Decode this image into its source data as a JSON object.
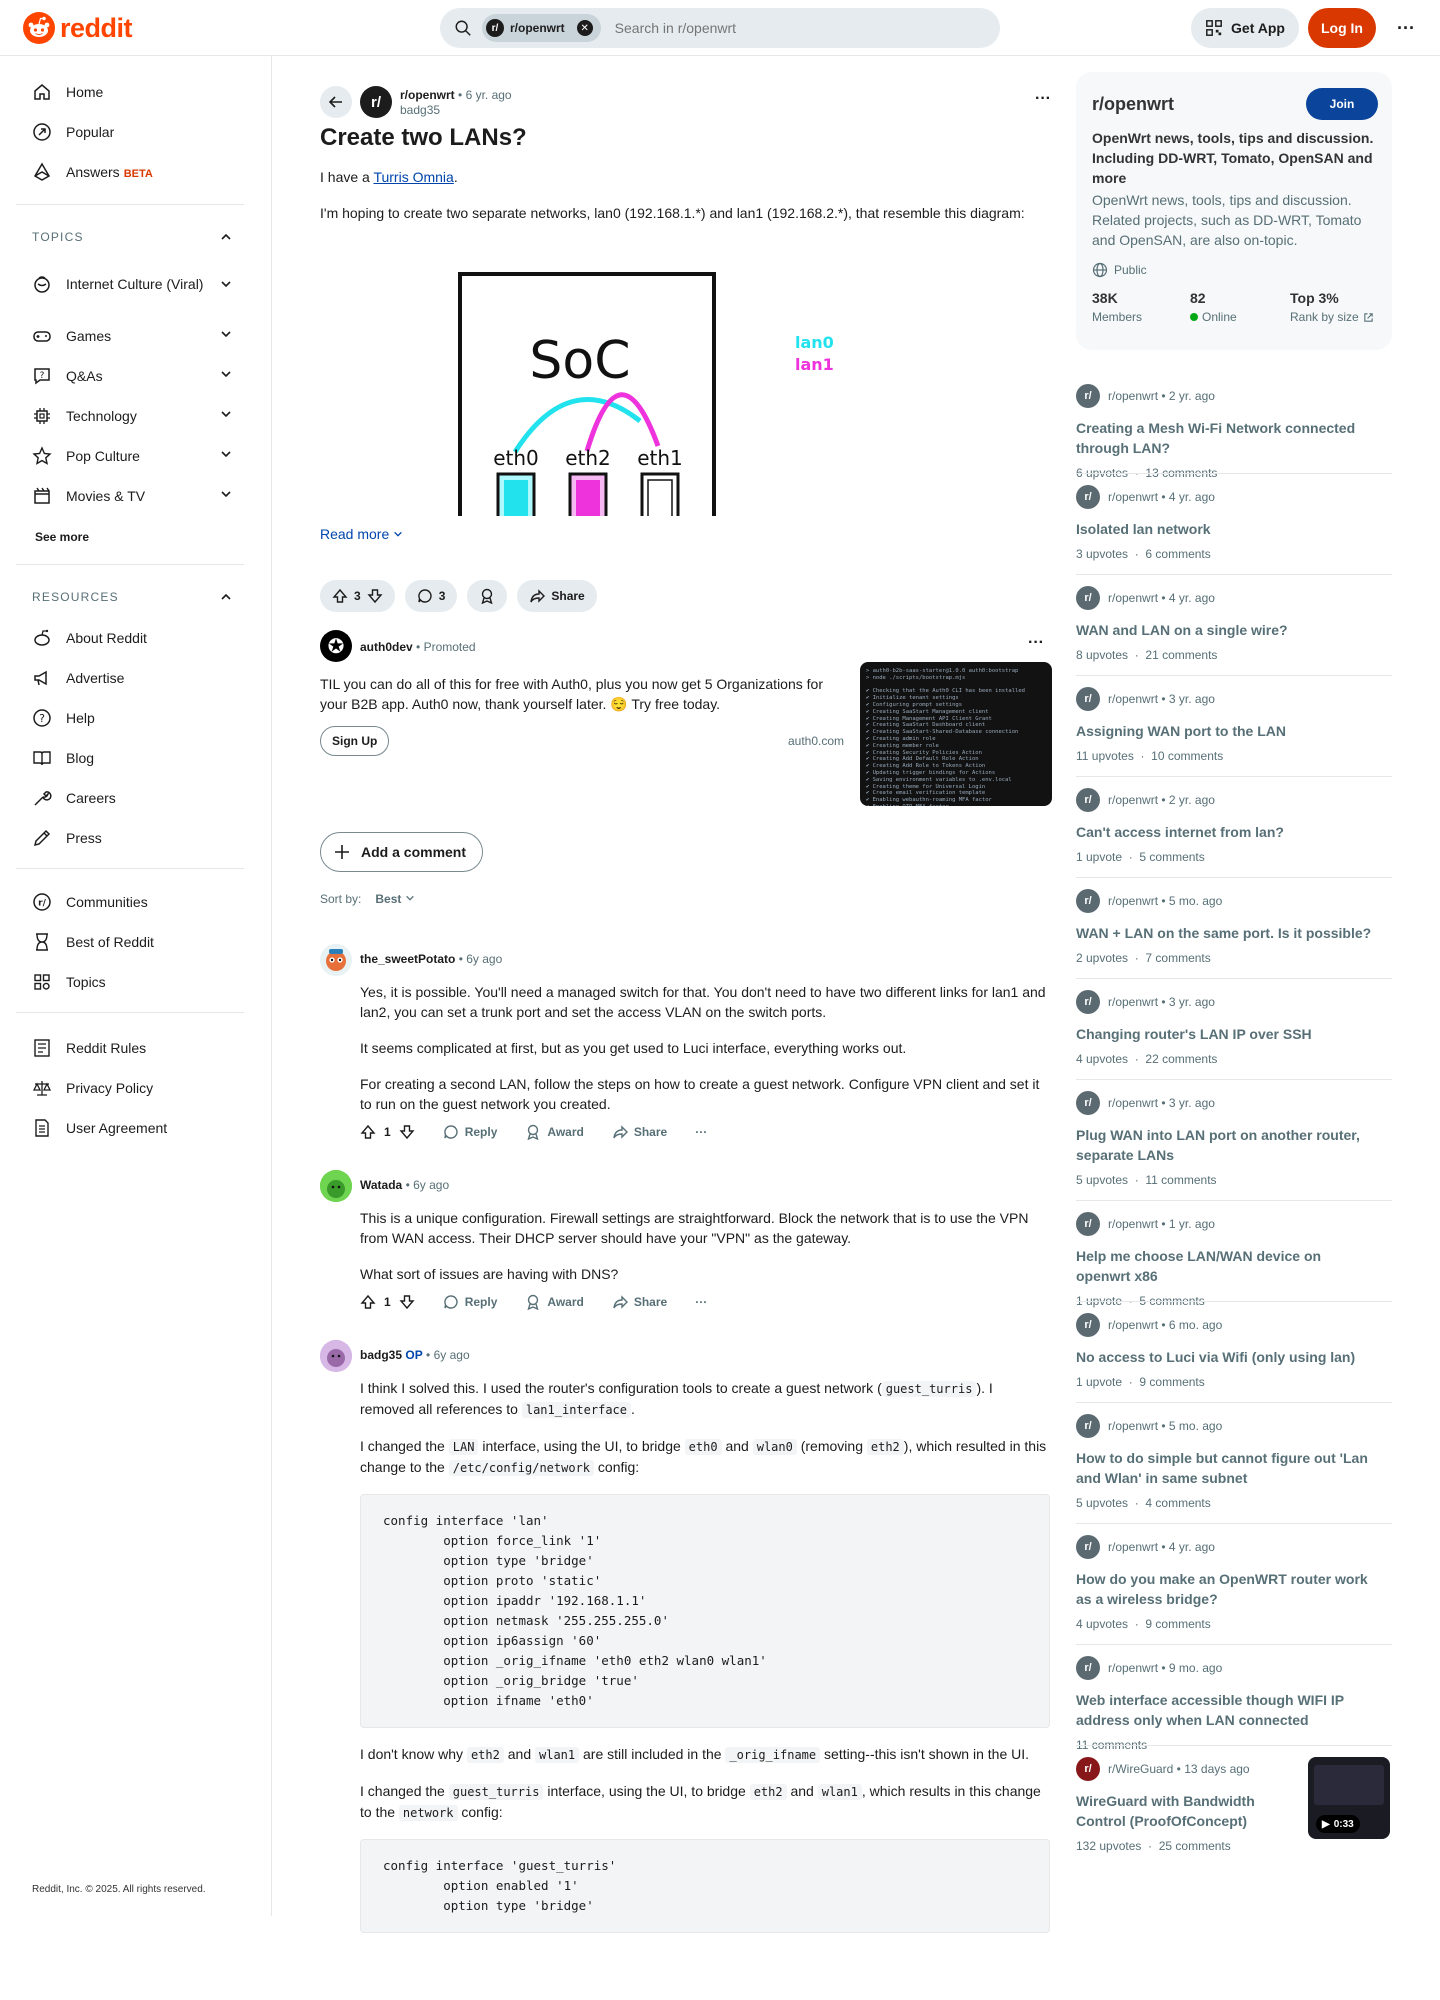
{
  "header": {
    "logo_text": "reddit",
    "search_chip": "r/openwrt",
    "search_placeholder": "Search in r/openwrt",
    "get_app": "Get App",
    "login": "Log In",
    "more": "···",
    "brand_color": "#ff4500"
  },
  "sidebar": {
    "main_items": [
      {
        "label": "Home",
        "icon": "home-icon"
      },
      {
        "label": "Popular",
        "icon": "popular-icon"
      },
      {
        "label": "Answers",
        "badge": "BETA",
        "icon": "answers-icon"
      }
    ],
    "topics_header": "TOPICS",
    "topics": [
      {
        "label": "Internet Culture (Viral)",
        "icon": "internet-culture-icon"
      },
      {
        "label": "Games",
        "icon": "gamepad-icon"
      },
      {
        "label": "Q&As",
        "icon": "qa-icon"
      },
      {
        "label": "Technology",
        "icon": "chip-icon"
      },
      {
        "label": "Pop Culture",
        "icon": "star-icon"
      },
      {
        "label": "Movies & TV",
        "icon": "film-icon"
      }
    ],
    "see_more": "See more",
    "resources_header": "RESOURCES",
    "resources": [
      {
        "label": "About Reddit",
        "icon": "alien-icon"
      },
      {
        "label": "Advertise",
        "icon": "megaphone-icon"
      },
      {
        "label": "Help",
        "icon": "help-icon"
      },
      {
        "label": "Blog",
        "icon": "book-icon"
      },
      {
        "label": "Careers",
        "icon": "wrench-icon"
      },
      {
        "label": "Press",
        "icon": "pen-icon"
      }
    ],
    "community_items": [
      {
        "label": "Communities",
        "icon": "communities-icon"
      },
      {
        "label": "Best of Reddit",
        "icon": "hourglass-icon"
      },
      {
        "label": "Topics",
        "icon": "grid-icon"
      }
    ],
    "legal_items": [
      {
        "label": "Reddit Rules",
        "icon": "rules-icon"
      },
      {
        "label": "Privacy Policy",
        "icon": "scale-icon"
      },
      {
        "label": "User Agreement",
        "icon": "document-icon"
      }
    ],
    "copyright": "Reddit, Inc. © 2025. All rights reserved."
  },
  "post": {
    "subreddit": "r/openwrt",
    "time": "6 yr. ago",
    "author": "badg35",
    "title": "Create two LANs?",
    "p1_prefix": "I have a ",
    "p1_link": "Turris Omnia",
    "p1_suffix": ".",
    "p2": "I'm hoping to create two separate networks, lan0 (192.168.1.*) and lan1 (192.168.2.*), that resemble this diagram:",
    "diagram": {
      "soc": "SoC",
      "ports": [
        "eth0",
        "eth2",
        "eth1"
      ],
      "legend": [
        "lan0",
        "lan1"
      ],
      "colors": {
        "lan0": "#22e2ee",
        "lan1": "#ee33dd"
      }
    },
    "read_more": "Read more",
    "votes": "3",
    "comments": "3",
    "share": "Share"
  },
  "promo": {
    "name": "auth0dev",
    "label": "Promoted",
    "text": "TIL you can do all of this for free with Auth0, plus you now get 5 Organizations for your B2B app. Auth0 now, thank yourself later. 😌 Try free today.",
    "cta": "Sign Up",
    "domain": "auth0.com",
    "terminal_lines": [
      "> auth0-b2b-saas-starter@1.0.0 auth0:bootstrap",
      "> node ./scripts/bootstrap.mjs",
      "",
      "✔ Checking that the Auth0 CLI has been installed",
      "✔ Initialize tenant settings",
      "✔ Configuring prompt settings",
      "✔ Creating SaaStart Management client",
      "✔ Creating Management API Client Grant",
      "✔ Creating SaaStart Dashboard client",
      "✔ Creating SaaStart-Shared-Database connection",
      "✔ Creating admin role",
      "✔ Creating member role",
      "✔ Creating Security Policies Action",
      "✔ Creating Add Default Role Action",
      "✔ Creating Add Role to Tokens Action",
      "✔ Updating trigger bindings for Actions",
      "✔ Saving environment variables to .env.local",
      "✔ Creating theme for Universal Login",
      "✔ Create email verification template",
      "✔ Enabling webauthn-roaming MFA factor",
      "✔ Enabling OTP MFA factor",
      "✔ best.dev@DL446714 auth0-b2b-saas-starter % ▮"
    ]
  },
  "comment_box": {
    "add": "Add a comment",
    "sort_label": "Sort by:",
    "sort_value": "Best"
  },
  "comments": [
    {
      "author": "the_sweetPotato",
      "time": "6y ago",
      "paragraphs": [
        "Yes, it is possible. You'll need a managed switch for that. You don't need to have two different links for lan1 and lan2, you can set a trunk port and set the access VLAN on the switch ports.",
        "It seems complicated at first, but as you get used to Luci interface, everything works out.",
        "For creating a second LAN, follow the steps on how to create a guest network. Configure VPN client and set it to run on the guest network you created."
      ],
      "votes": "1",
      "reply": "Reply",
      "award": "Award",
      "share": "Share"
    },
    {
      "author": "Watada",
      "time": "6y ago",
      "paragraphs": [
        "This is a unique configuration. Firewall settings are straightforward. Block the network that is to use the VPN from WAN access. Their DHCP server should have your \"VPN\" as the gateway.",
        "What sort of issues are having with DNS?"
      ],
      "votes": "1",
      "reply": "Reply",
      "award": "Award",
      "share": "Share"
    },
    {
      "author": "badg35",
      "op": "OP",
      "time": "6y ago",
      "p1": [
        "I think I solved this. I used the router's configuration tools to create a guest network (",
        "guest_turris",
        "). I removed all references to ",
        "lan1_interface",
        "."
      ],
      "p2": [
        "I changed the ",
        "LAN",
        " interface, using the UI, to bridge ",
        "eth0",
        " and ",
        "wlan0",
        " (removing ",
        "eth2",
        "), which resulted in this change to the ",
        "/etc/config/network",
        " config:"
      ],
      "code1": "config interface 'lan'\n        option force_link '1'\n        option type 'bridge'\n        option proto 'static'\n        option ipaddr '192.168.1.1'\n        option netmask '255.255.255.0'\n        option ip6assign '60'\n        option _orig_ifname 'eth0 eth2 wlan0 wlan1'\n        option _orig_bridge 'true'\n        option ifname 'eth0'",
      "p3": [
        "I don't know why ",
        "eth2",
        " and ",
        "wlan1",
        " are still included in the ",
        "_orig_ifname",
        " setting--this isn't shown in the UI."
      ],
      "p4": [
        "I changed the ",
        "guest_turris",
        " interface, using the UI, to bridge ",
        "eth2",
        " and ",
        "wlan1",
        ", which results in this change to the ",
        "network",
        " config:"
      ],
      "code2": "config interface 'guest_turris'\n        option enabled '1'\n        option type 'bridge'"
    }
  ],
  "about": {
    "name": "r/openwrt",
    "join": "Join",
    "title": "OpenWrt news, tools, tips and discussion. Including DD-WRT, Tomato, OpenSAN and more",
    "description": "OpenWrt news, tools, tips and discussion. Related projects, such as DD-WRT, Tomato and OpenSAN, are also on-topic.",
    "visibility": "Public",
    "members_value": "38K",
    "members_label": "Members",
    "online_value": "82",
    "online_label": "Online",
    "rank_value": "Top 3%",
    "rank_label": "Rank by size"
  },
  "related": [
    {
      "sub": "r/openwrt",
      "time": "2 yr. ago",
      "title": "Creating a Mesh Wi-Fi Network connected through LAN?",
      "upvotes": "6 upvotes",
      "comments": "13 comments"
    },
    {
      "sub": "r/openwrt",
      "time": "4 yr. ago",
      "title": "Isolated lan network",
      "upvotes": "3 upvotes",
      "comments": "6 comments"
    },
    {
      "sub": "r/openwrt",
      "time": "4 yr. ago",
      "title": "WAN and LAN on a single wire?",
      "upvotes": "8 upvotes",
      "comments": "21 comments"
    },
    {
      "sub": "r/openwrt",
      "time": "3 yr. ago",
      "title": "Assigning WAN port to the LAN",
      "upvotes": "11 upvotes",
      "comments": "10 comments"
    },
    {
      "sub": "r/openwrt",
      "time": "2 yr. ago",
      "title": "Can't access internet from lan?",
      "upvotes": "1 upvote",
      "comments": "5 comments"
    },
    {
      "sub": "r/openwrt",
      "time": "5 mo. ago",
      "title": "WAN + LAN on the same port. Is it possible?",
      "upvotes": "2 upvotes",
      "comments": "7 comments"
    },
    {
      "sub": "r/openwrt",
      "time": "3 yr. ago",
      "title": "Changing router's LAN IP over SSH",
      "upvotes": "4 upvotes",
      "comments": "22 comments"
    },
    {
      "sub": "r/openwrt",
      "time": "3 yr. ago",
      "title": "Plug WAN into LAN port on another router, separate LANs",
      "upvotes": "5 upvotes",
      "comments": "11 comments"
    },
    {
      "sub": "r/openwrt",
      "time": "1 yr. ago",
      "title": "Help me choose LAN/WAN device on openwrt x86",
      "upvotes": "1 upvote",
      "comments": "5 comments"
    },
    {
      "sub": "r/openwrt",
      "time": "6 mo. ago",
      "title": "No access to Luci via Wifi (only using lan)",
      "upvotes": "1 upvote",
      "comments": "9 comments"
    },
    {
      "sub": "r/openwrt",
      "time": "5 mo. ago",
      "title": "How to do simple but cannot figure out 'Lan and Wlan' in same subnet",
      "upvotes": "5 upvotes",
      "comments": "4 comments"
    },
    {
      "sub": "r/openwrt",
      "time": "4 yr. ago",
      "title": "How do you make an OpenWRT router work as a wireless bridge?",
      "upvotes": "4 upvotes",
      "comments": "9 comments"
    },
    {
      "sub": "r/openwrt",
      "time": "9 mo. ago",
      "title": "Web interface accessible though WIFI IP address only when LAN connected",
      "upvotes": "",
      "comments": "11 comments"
    },
    {
      "sub": "r/WireGuard",
      "time": "13 days ago",
      "title": "WireGuard with Bandwidth Control (ProofOfConcept)",
      "upvotes": "132 upvotes",
      "comments": "25 comments",
      "video": "0:33"
    }
  ]
}
